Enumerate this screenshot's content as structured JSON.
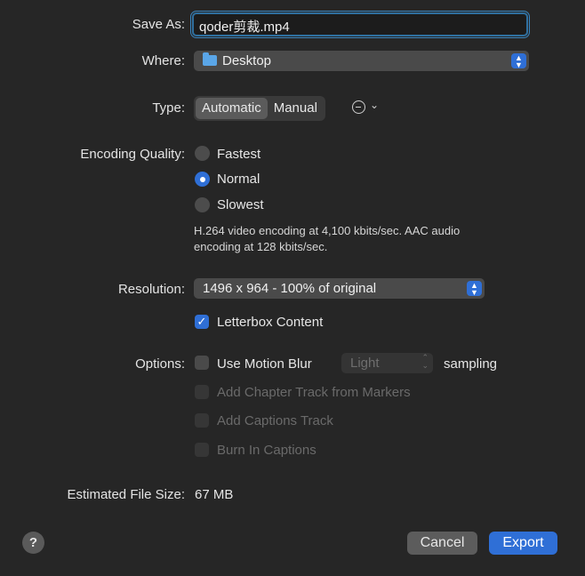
{
  "save_as": {
    "label": "Save As:",
    "value": "qoder剪裁.mp4"
  },
  "where": {
    "label": "Where:",
    "value": "Desktop",
    "icon": "folder-icon"
  },
  "type": {
    "label": "Type:",
    "options": [
      "Automatic",
      "Manual"
    ],
    "selected": "Automatic"
  },
  "encoding": {
    "label": "Encoding Quality:",
    "options": [
      "Fastest",
      "Normal",
      "Slowest"
    ],
    "selected": "Normal",
    "info_line1": "H.264 video encoding at 4,100 kbits/sec.  AAC audio",
    "info_line2": "encoding at 128 kbits/sec."
  },
  "resolution": {
    "label": "Resolution:",
    "value": "1496 x 964 - 100% of original"
  },
  "letterbox": {
    "label": "Letterbox Content",
    "checked": true
  },
  "options": {
    "label": "Options:",
    "motion_blur": "Use Motion Blur",
    "sampling_value": "Light",
    "sampling_label": "sampling",
    "chapter": "Add Chapter Track from Markers",
    "captions": "Add Captions Track",
    "burn": "Burn In Captions"
  },
  "file_size": {
    "label": "Estimated File Size:",
    "value": "67 MB"
  },
  "buttons": {
    "help": "?",
    "cancel": "Cancel",
    "export": "Export"
  },
  "colors": {
    "accent": "#2f6fd6",
    "background": "#262626"
  }
}
